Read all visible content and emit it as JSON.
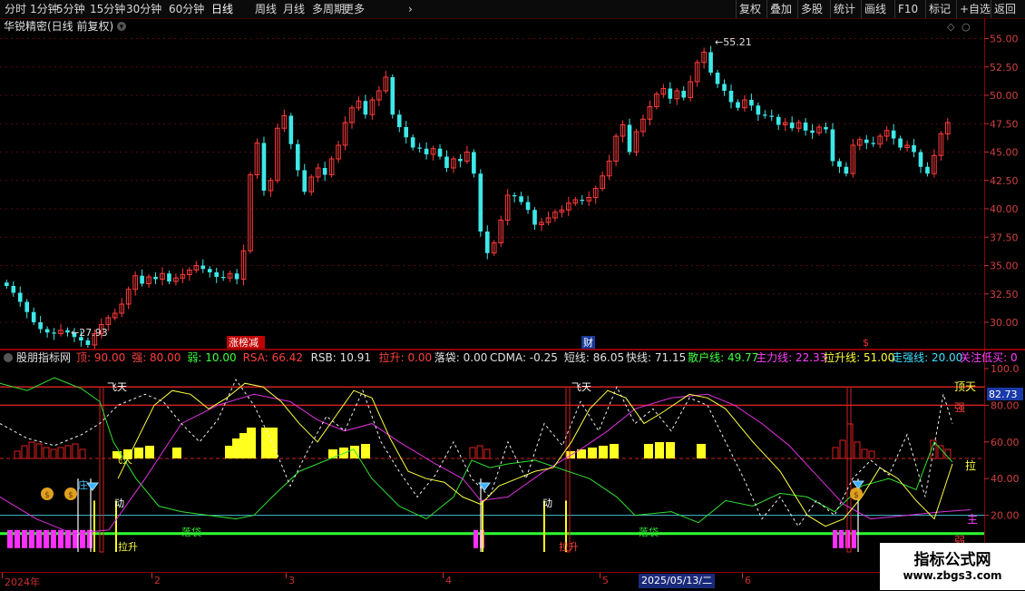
{
  "toolbar": {
    "left": [
      {
        "id": "tb-1min",
        "label": "分时"
      },
      {
        "id": "tb-1m",
        "label": "1分钟"
      },
      {
        "id": "tb-5m",
        "label": "5分钟"
      },
      {
        "id": "tb-15m",
        "label": "15分钟"
      },
      {
        "id": "tb-30m",
        "label": "30分钟"
      },
      {
        "id": "tb-60m",
        "label": "60分钟"
      },
      {
        "id": "tb-day",
        "label": "日线",
        "active": true
      },
      {
        "id": "tb-week",
        "label": "周线"
      },
      {
        "id": "tb-month",
        "label": "月线"
      },
      {
        "id": "tb-multi",
        "label": "多周期"
      },
      {
        "id": "tb-more",
        "label": "更多"
      }
    ],
    "right": [
      "复权",
      "叠加",
      "多股",
      "统计",
      "画线",
      "F10",
      "标记",
      "+自选",
      "返回"
    ]
  },
  "price_panel": {
    "title": "华锐精密(日线 前复权)",
    "y_ticks": [
      "55.00",
      "52.50",
      "50.00",
      "47.50",
      "45.00",
      "42.50",
      "40.00",
      "37.50",
      "35.00",
      "32.50",
      "30.00"
    ],
    "high_label": "55.21",
    "low_label": "27.93",
    "markers": [
      "涨榜减",
      "财",
      "$"
    ]
  },
  "indicator_panel": {
    "title": "股朋指标网",
    "params": [
      {
        "text": "顶: 90.00",
        "color": "#ff4040"
      },
      {
        "text": "强: 80.00",
        "color": "#ff4040"
      },
      {
        "text": "弱: 10.00",
        "color": "#40ff40"
      },
      {
        "text": "RSA: 66.42",
        "color": "#ff4040"
      },
      {
        "text": "RSB: 10.91",
        "color": "#e0e0e0"
      },
      {
        "text": "拉升: 0.00",
        "color": "#ff4040"
      },
      {
        "text": "落袋: 0.00",
        "color": "#e0e0e0"
      },
      {
        "text": "CDMA: -0.25",
        "color": "#e0e0e0"
      },
      {
        "text": "短线: 86.05",
        "color": "#e0e0e0"
      },
      {
        "text": "快线: 71.15",
        "color": "#e0e0e0"
      },
      {
        "text": "散户线: 49.77",
        "color": "#40ff40"
      },
      {
        "text": "主力线: 22.33",
        "color": "#ff40ff"
      },
      {
        "text": "拉升线: 51.00",
        "color": "#ffff40"
      },
      {
        "text": "走强线: 20.00",
        "color": "#40e0ff"
      },
      {
        "text": "关注低买: 0",
        "color": "#ff40ff"
      }
    ],
    "y_ticks": [
      "100.0",
      "80.00",
      "60.00",
      "40.00",
      "20.00"
    ],
    "current_value": "82.73",
    "right_labels": {
      "top": "顶天",
      "strong": "强",
      "pull": "拉",
      "main": "主",
      "weak": "弱"
    },
    "annotations": {
      "fly": "飞天",
      "move": "动",
      "bag": "落袋",
      "rise": "拉升",
      "zhuang": "庄"
    }
  },
  "date_axis": {
    "labels": [
      "2024年",
      "2",
      "3",
      "4",
      "5",
      "6"
    ],
    "selected": "2025/05/13/二"
  },
  "watermark": {
    "line1": "指标公式网",
    "line2": "www.zbgs3.com"
  },
  "chart_data": {
    "type": "candlestick",
    "ylim": [
      28,
      56
    ],
    "closes": [
      33.2,
      32.6,
      31.8,
      30.9,
      30.0,
      29.4,
      29.1,
      29.0,
      29.3,
      29.1,
      28.7,
      28.4,
      28.0,
      29.0,
      29.8,
      30.4,
      30.8,
      31.6,
      32.9,
      34.1,
      33.4,
      34.0,
      33.8,
      34.3,
      33.6,
      33.9,
      34.2,
      34.6,
      35.0,
      34.7,
      34.4,
      34.0,
      33.9,
      34.3,
      33.8,
      36.3,
      43.0,
      45.8,
      41.6,
      42.5,
      47.1,
      48.2,
      45.7,
      43.4,
      41.5,
      42.8,
      43.6,
      43.0,
      44.4,
      45.6,
      47.6,
      48.9,
      49.5,
      48.3,
      49.6,
      50.4,
      51.6,
      48.3,
      47.2,
      46.3,
      45.4,
      45.3,
      44.8,
      45.3,
      44.6,
      43.6,
      44.4,
      44.2,
      45.0,
      43.1,
      38.0,
      36.1,
      37.0,
      39.0,
      41.2,
      41.1,
      40.6,
      39.9,
      38.6,
      38.8,
      39.2,
      39.7,
      39.9,
      40.5,
      40.8,
      40.7,
      41.0,
      41.8,
      42.9,
      44.2,
      46.4,
      47.4,
      45.0,
      46.8,
      47.9,
      49.0,
      50.1,
      50.6,
      49.7,
      50.4,
      49.8,
      51.2,
      52.9,
      53.8,
      52.0,
      51.0,
      50.4,
      49.4,
      48.9,
      49.6,
      49.1,
      48.3,
      48.2,
      48.1,
      47.4,
      47.6,
      47.1,
      47.6,
      46.9,
      46.7,
      47.2,
      47.0,
      44.2,
      43.7,
      43.1,
      45.6,
      46.1,
      45.8,
      45.7,
      46.4,
      46.9,
      46.2,
      45.4,
      45.6,
      45.0,
      43.7,
      43.1,
      44.7,
      46.6,
      47.6
    ]
  }
}
